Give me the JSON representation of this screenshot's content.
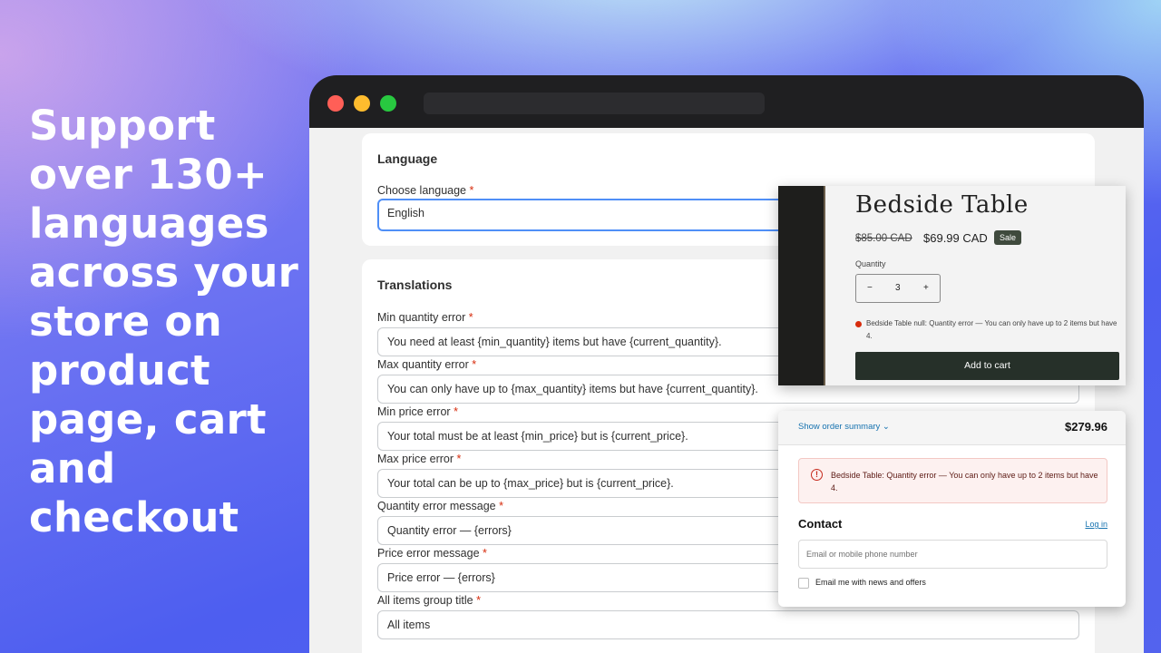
{
  "headline": "Support over 130+ languages across your store on product page, cart and checkout",
  "colors": {
    "accent_focus": "#4f8ff7",
    "required": "#d72c0d",
    "button_dark": "#263029",
    "link": "#1773b0"
  },
  "language_card": {
    "title": "Language",
    "field_label": "Choose language",
    "required_mark": "*",
    "value": "English"
  },
  "translations_card": {
    "title": "Translations",
    "fields": [
      {
        "label": "Min quantity error",
        "value": "You need at least {min_quantity} items but have {current_quantity}."
      },
      {
        "label": "Max quantity error",
        "value": "You can only have up to {max_quantity} items but have {current_quantity}."
      },
      {
        "label": "Min price error",
        "value": "Your total must be at least {min_price} but is {current_price}."
      },
      {
        "label": "Max price error",
        "value": "Your total can be up to {max_price} but is {current_price}."
      },
      {
        "label": "Quantity error message",
        "value": "Quantity error — {errors}"
      },
      {
        "label": "Price error message",
        "value": "Price error — {errors}"
      },
      {
        "label": "All items group title",
        "value": "All items"
      }
    ]
  },
  "product": {
    "title": "Bedside Table",
    "old_price": "$85.00 CAD",
    "new_price": "$69.99 CAD",
    "badge": "Sale",
    "quantity_label": "Quantity",
    "quantity_minus": "−",
    "quantity_value": "3",
    "quantity_plus": "+",
    "error": "Bedside Table null: Quantity error — You can only have up to 2 items but have 4.",
    "add_to_cart": "Add to cart"
  },
  "checkout": {
    "show_summary": "Show order summary",
    "chevron": "⌄",
    "total": "$279.96",
    "error_icon": "!",
    "error": "Bedside Table: Quantity error — You can only have up to 2 items but have 4.",
    "contact_title": "Contact",
    "login": "Log in",
    "email_placeholder": "Email or mobile phone number",
    "newsletter": "Email me with news and offers"
  }
}
